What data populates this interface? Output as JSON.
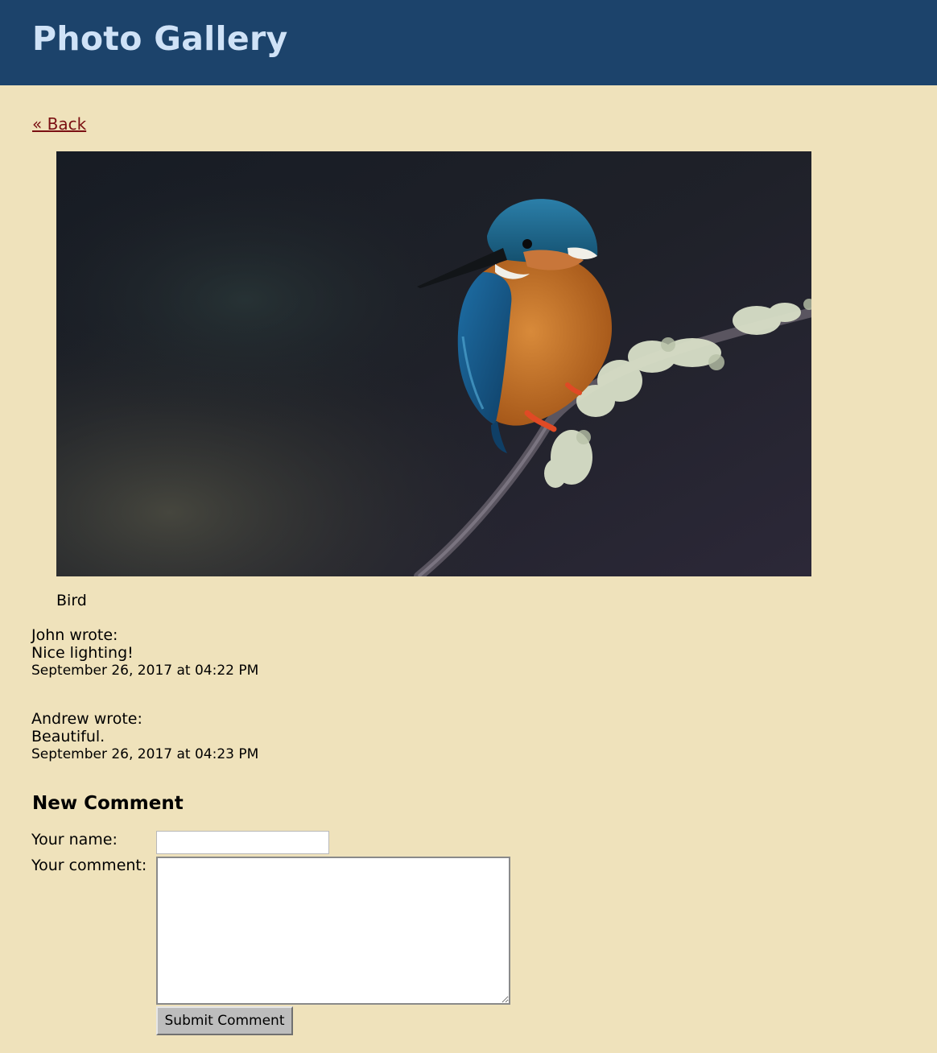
{
  "header": {
    "title": "Photo Gallery"
  },
  "nav": {
    "back_label": "« Back"
  },
  "photo": {
    "caption": "Bird"
  },
  "comments": [
    {
      "author_line": "John wrote:",
      "text": "Nice lighting!",
      "date": "September 26, 2017 at 04:22 PM"
    },
    {
      "author_line": "Andrew wrote:",
      "text": "Beautiful.",
      "date": "September 26, 2017 at 04:23 PM"
    }
  ],
  "form": {
    "heading": "New Comment",
    "name_label": "Your name:",
    "comment_label": "Your comment:",
    "name_value": "",
    "comment_value": "",
    "submit_label": "Submit Comment"
  },
  "colors": {
    "header_bg": "#1c436b",
    "header_text": "#cfe2f7",
    "page_bg": "#efe2bb",
    "link": "#7a0f12"
  }
}
